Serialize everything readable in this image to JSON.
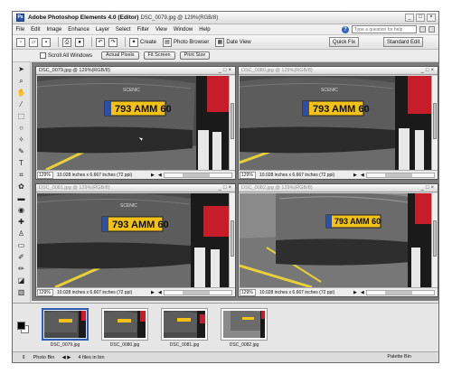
{
  "app": {
    "title": "Adobe Photoshop Elements 4.0 (Editor)",
    "active_doc": "DSC_0079.jpg @ 129%(RGB/8)"
  },
  "window_controls": [
    "_",
    "□",
    "×"
  ],
  "menu": [
    "File",
    "Edit",
    "Image",
    "Enhance",
    "Layer",
    "Select",
    "Filter",
    "View",
    "Window",
    "Help"
  ],
  "help": {
    "placeholder": "Type a question for help",
    "icon": "help-icon"
  },
  "toolbar": {
    "create_label": "Create",
    "photo_browser_label": "Photo Browser",
    "date_view_label": "Date View",
    "quick_fix_label": "Quick Fix",
    "standard_edit_label": "Standard Edit"
  },
  "options_bar": {
    "scroll_all_label": "Scroll All Windows",
    "actual_pixels_label": "Actual Pixels",
    "fit_screen_label": "Fit Screen",
    "print_size_label": "Print Size"
  },
  "documents": [
    {
      "title": "DSC_0079.jpg @ 129%(RGB/8)",
      "zoom": "129%",
      "info": "10.028 inches x 6.667 inches (72 ppi)",
      "plate": "793 AMM 60",
      "active": true
    },
    {
      "title": "DSC_0080.jpg @ 129%(RGB/8)",
      "zoom": "129%",
      "info": "10.028 inches x 6.667 inches (72 ppi)",
      "plate": "793 AMM 60",
      "active": false
    },
    {
      "title": "DSC_0081.jpg @ 129%(RGB/8)",
      "zoom": "129%",
      "info": "10.028 inches x 6.667 inches (72 ppi)",
      "plate": "793 AMM 60",
      "active": false
    },
    {
      "title": "DSC_0082.jpg @ 129%(RGB/8)",
      "zoom": "129%",
      "info": "10.028 inches x 6.667 inches (72 ppi)",
      "plate": "793 AMM 60",
      "active": false
    }
  ],
  "car_model": "SCENIC",
  "bin": {
    "files": [
      "DSC_0079.jpg",
      "DSC_0080.jpg",
      "DSC_0081.jpg",
      "DSC_0082.jpg"
    ],
    "photo_bin_label": "Photo Bin",
    "count_label": "4 files in bin",
    "palette_bin_label": "Palette Bin"
  },
  "tools": [
    "move-tool-icon",
    "zoom-tool-icon",
    "hand-tool-icon",
    "eyedropper-tool-icon",
    "marquee-tool-icon",
    "lasso-tool-icon",
    "magic-wand-tool-icon",
    "selection-brush-tool-icon",
    "type-tool-icon",
    "crop-tool-icon",
    "cookie-cutter-tool-icon",
    "straighten-tool-icon",
    "red-eye-tool-icon",
    "healing-brush-tool-icon",
    "clone-stamp-tool-icon",
    "eraser-tool-icon",
    "brush-tool-icon",
    "pencil-tool-icon",
    "paint-bucket-tool-icon",
    "gradient-tool-icon",
    "shape-tool-icon",
    "blur-tool-icon",
    "sponge-tool-icon"
  ],
  "colors": {
    "accent": "#2e5fb5",
    "plate_yellow": "#f2c21b",
    "workspace": "#7c7c7c"
  }
}
